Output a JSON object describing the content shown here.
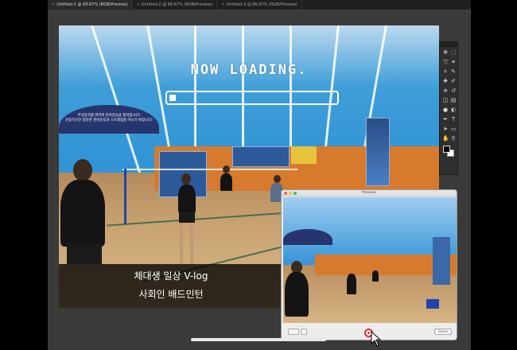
{
  "tabs": [
    {
      "label": "Untitled-1 @ 66.67% (RGB/Preview)",
      "active": true
    },
    {
      "label": "Untitled-2 @ 66.67% (RGB/Preview)",
      "active": false
    },
    {
      "label": "Untitled-3 @ 66.67% (RGB/Preview)",
      "active": false
    }
  ],
  "tab_close_glyph": "×",
  "video": {
    "loading_title": "NOW LOADING.",
    "loading_progress": 0.04,
    "banner_line1": "부상방지를 위하여 준비운동을 철저합시다!",
    "banner_line2": "운동하기전 충분한 준비운동과 스트레칭을 하시기 바랍니다!",
    "caption_line1": "체대생 일상 V-log",
    "caption_line2": "사회인 배드민턴"
  },
  "preview": {
    "title": "Preview",
    "left_label": "",
    "right_label": "Done"
  },
  "tools": [
    "move-icon",
    "marquee-icon",
    "lasso-icon",
    "magic-wand-icon",
    "crop-icon",
    "eyedropper-icon",
    "healing-icon",
    "brush-icon",
    "stamp-icon",
    "history-brush-icon",
    "eraser-icon",
    "gradient-icon",
    "blur-icon",
    "dodge-icon",
    "pen-icon",
    "type-icon",
    "path-select-icon",
    "shape-icon",
    "hand-icon",
    "zoom-icon"
  ],
  "colors": {
    "record_red": "#d93030",
    "swatch_foreground": "#000000",
    "swatch_background": "#ffffff"
  }
}
